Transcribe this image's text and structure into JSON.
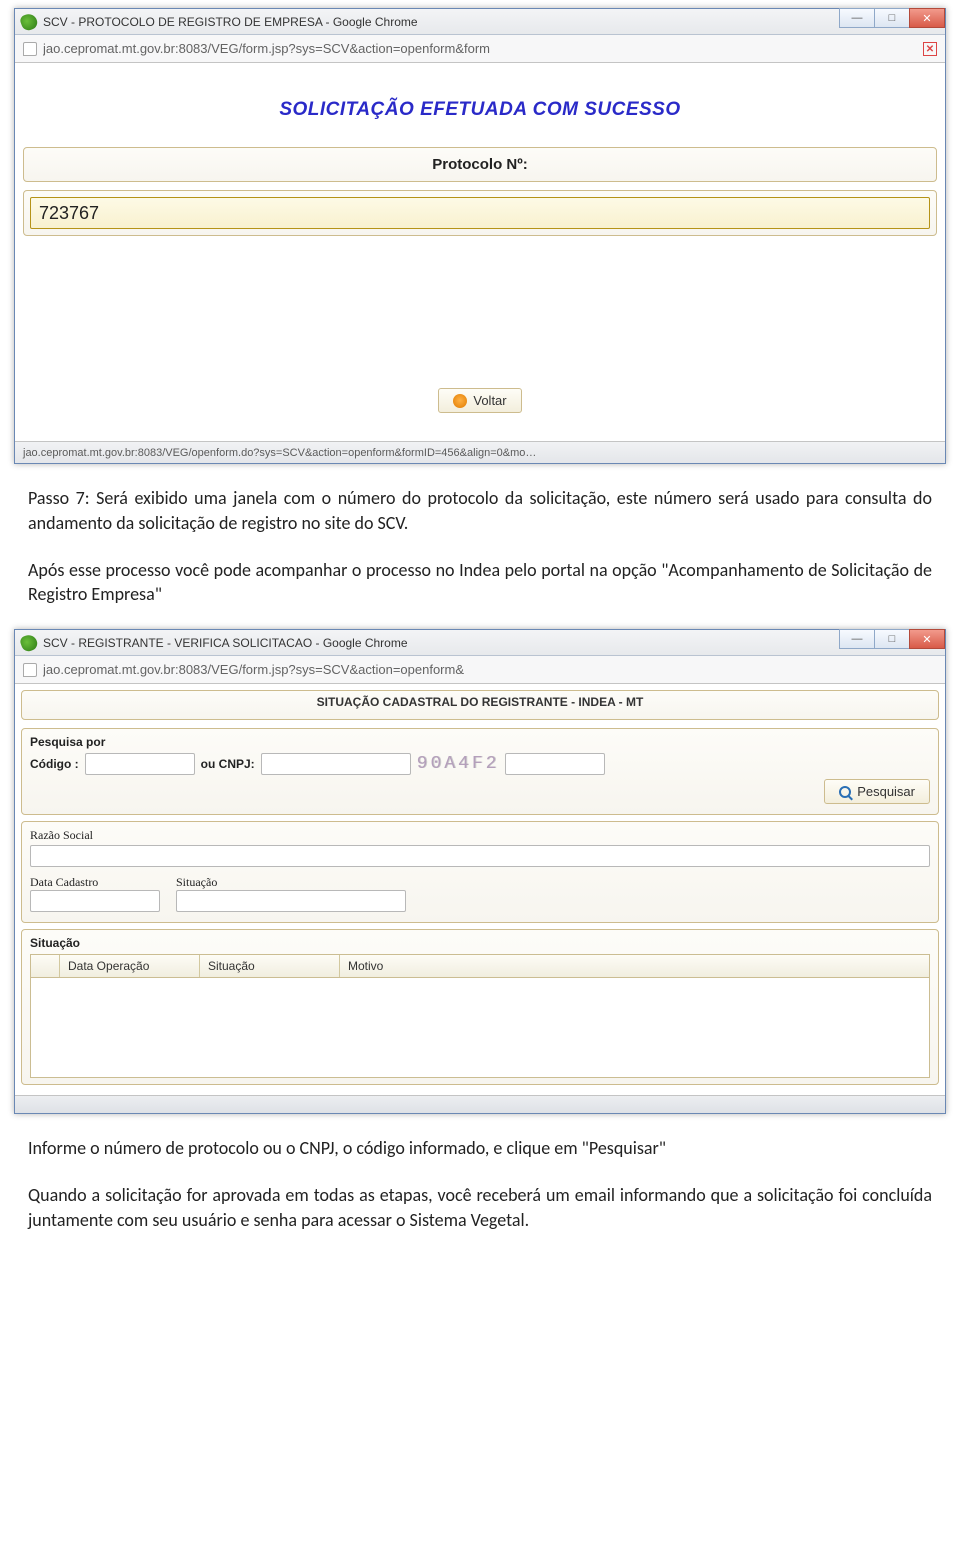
{
  "window1": {
    "title": "SCV - PROTOCOLO DE REGISTRO DE EMPRESA - Google Chrome",
    "url": "jao.cepromat.mt.gov.br:8083/VEG/form.jsp?sys=SCV&action=openform&form",
    "success_heading": "SOLICITAÇÃO EFETUADA COM SUCESSO",
    "protocol_label": "Protocolo Nº:",
    "protocol_value": "723767",
    "back_button": "Voltar",
    "status": "jao.cepromat.mt.gov.br:8083/VEG/openform.do?sys=SCV&action=openform&formID=456&align=0&mo…"
  },
  "body_text": {
    "p1": "Passo 7: Será exibido uma janela com o número do protocolo da solicitação, este número será usado para consulta do andamento da solicitação de registro no site do SCV.",
    "p2": "Após esse processo você pode acompanhar o processo no Indea pelo portal na opção \"Acompanhamento de Solicitação de Registro Empresa\"",
    "p3": "Informe o número de protocolo ou o CNPJ, o código informado, e clique em \"Pesquisar\"",
    "p4": "Quando a solicitação for aprovada em todas as etapas, você receberá um email informando que a solicitação foi concluída juntamente com seu usuário e senha para acessar o Sistema Vegetal."
  },
  "window2": {
    "title": "SCV - REGISTRANTE - VERIFICA SOLICITACAO - Google Chrome",
    "url": "jao.cepromat.mt.gov.br:8083/VEG/form.jsp?sys=SCV&action=openform&",
    "page_title": "SITUAÇÃO CADASTRAL DO REGISTRANTE - INDEA - MT",
    "search_section": "Pesquisa por",
    "codigo_label": "Código :",
    "ou_cnpj_label": "ou CNPJ:",
    "captcha": "90A4F2",
    "search_button": "Pesquisar",
    "razao_label": "Razão Social",
    "data_cadastro_label": "Data Cadastro",
    "situacao_label": "Situação",
    "situacao_section": "Situação",
    "columns": {
      "c1": "Data Operação",
      "c2": "Situação",
      "c3": "Motivo"
    }
  }
}
